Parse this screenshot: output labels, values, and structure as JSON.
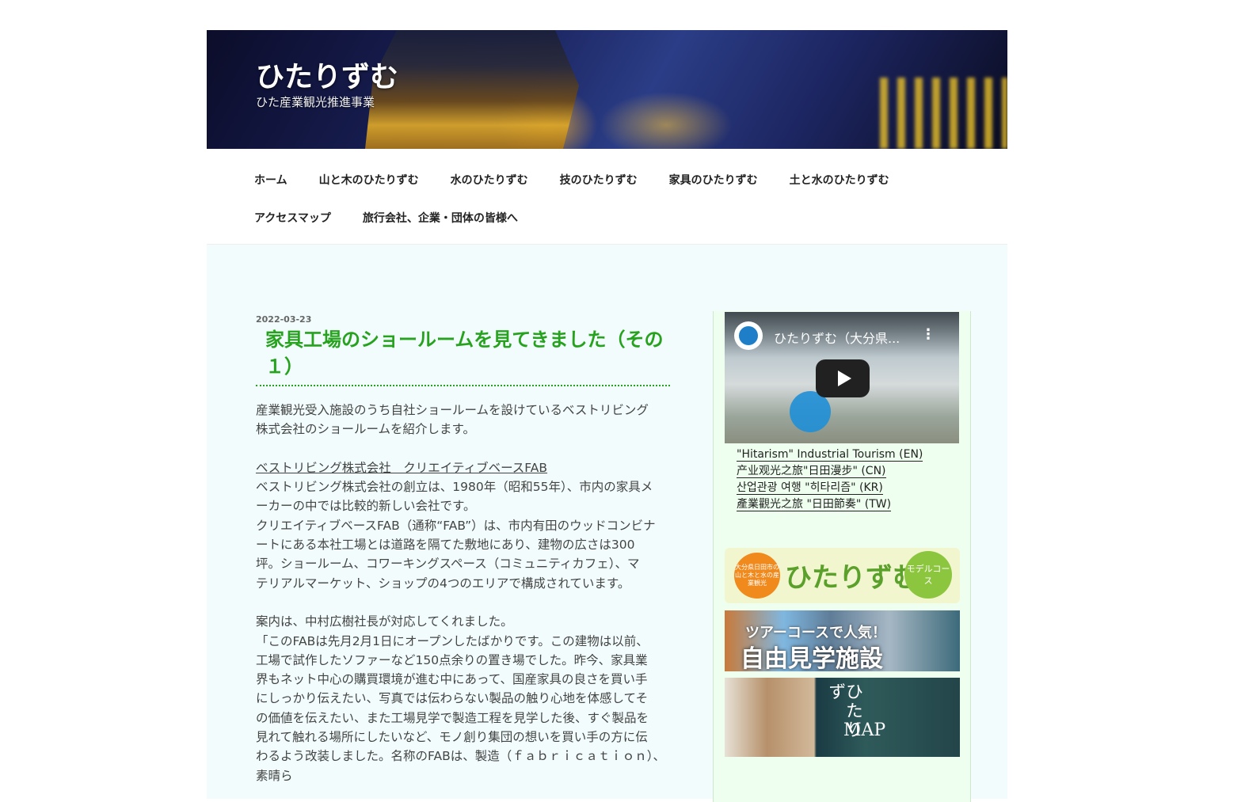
{
  "site": {
    "title": "ひたりずむ",
    "description": "ひた産業観光推進事業"
  },
  "nav": {
    "row1": [
      "ホーム",
      "山と木のひたりずむ",
      "水のひたりずむ",
      "技のひたりずむ",
      "家具のひたりずむ",
      "土と水のひたりずむ"
    ],
    "row2": [
      "アクセスマップ",
      "旅行会社、企業・団体の皆様へ"
    ]
  },
  "post": {
    "date": "2022-03-23",
    "title": "家具工場のショールームを見てきました（その１）",
    "p1": [
      "産業観光受入施設のうち自社ショールームを設けているベストリビング",
      "株式会社のショールームを紹介します。"
    ],
    "link": "ベストリビング株式会社　クリエイティブベースFAB",
    "p2": [
      "ベストリビング株式会社の創立は、1980年（昭和55年）、市内の家具メ",
      "ーカーの中では比較的新しい会社です。",
      "クリエイティブベースFAB（通称“FAB”）は、市内有田のウッドコンビナ",
      "ートにある本社工場とは道路を隔てた敷地にあり、建物の広さは300",
      "坪。ショールーム、コワーキングスペース（コミュニティカフェ）、マ",
      "テリアルマーケット、ショップの4つのエリアで構成されています。"
    ],
    "p3": [
      "案内は、中村広樹社長が対応してくれました。",
      "「このFABは先月2月1日にオープンしたばかりです。この建物は以前、",
      "工場で試作したソファーなど150点余りの置き場でした。昨今、家具業",
      "界もネット中心の購買環境が進む中にあって、国産家具の良さを買い手",
      "にしっかり伝えたい、写真では伝わらない製品の触り心地を体感してそ",
      "の価値を伝えたい、また工場見学で製造工程を見学した後、すぐ製品を",
      "見れて触れる場所にしたいなど、モノ創り集団の想いを買い手の方に伝",
      "わるよう改装しました。名称のFABは、製造（ｆａｂｒｉｃａｔｉｏｎ）、素晴ら"
    ]
  },
  "sidebar": {
    "video_title": "ひたりずむ（大分県...",
    "video_links": [
      "\"Hitarism\" Industrial Tourism (EN)",
      "产业观光之旅\"日田漫步\" (CN)",
      "산업관광 여행 \"히타리즘\" (KR)",
      "產業觀光之旅 \"日田節奏\" (TW)"
    ],
    "banner_model": {
      "left": "大分県日田市の山と木と水の産業観光",
      "main": "ひたりずむ",
      "right": "モデルコース"
    },
    "banner_tour": {
      "line1": "ツアーコースで人気！",
      "line2": "自由見学施設"
    },
    "banner_map": {
      "vertical": "ひたりず",
      "text": "MAP"
    }
  },
  "colors": {
    "accent_green": "#27a21f",
    "main_bg": "#f2fcfc",
    "sidebar_bg": "#efffef"
  }
}
